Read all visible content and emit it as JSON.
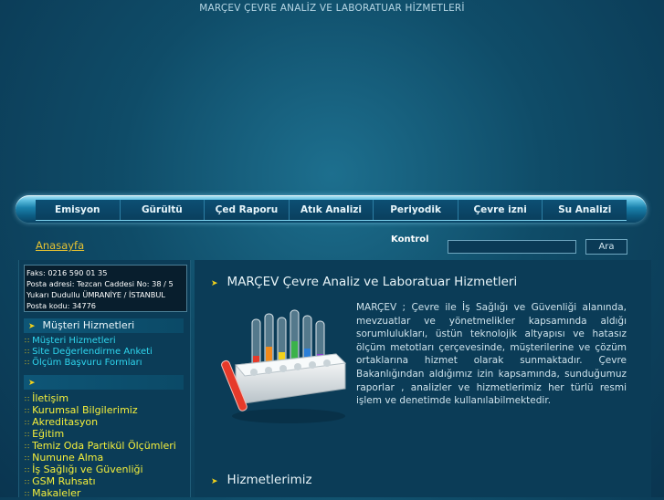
{
  "header": {
    "title": "MARÇEV ÇEVRE ANALİZ VE LABORATUAR HİZMETLERİ"
  },
  "nav": {
    "items": [
      "Emisyon",
      "Gürültü",
      "Çed Raporu",
      "Atık Analizi",
      "Periyodik",
      "Çevre izni",
      "Su Analizi"
    ]
  },
  "breadcrumb": {
    "home": "Anasayfa"
  },
  "search": {
    "label": "Kontrol",
    "value": "",
    "button": "Ara"
  },
  "contact": {
    "lines": [
      "Faks: 0216 590 01 35",
      "Posta adresi: Tezcan Caddesi No: 38 / 5",
      "Yukarı Dudullu ÜMRANİYE / İSTANBUL",
      "Posta kodu: 34776"
    ]
  },
  "sidebar": {
    "customer_heading": "Müşteri Hizmetleri",
    "customer_links": [
      "Müşteri Hizmetleri",
      "Site Değerlendirme Anketi",
      "Ölçüm Başvuru Formları"
    ],
    "second_heading": "",
    "links": [
      "İletişim",
      "Kurumsal Bilgilerimiz",
      "Akreditasyon",
      "Eğitim",
      "Temiz Oda Partikül Ölçümleri",
      "Numune Alma",
      "İş Sağlığı ve Güvenliği",
      "GSM Ruhsatı",
      "Makaleler"
    ]
  },
  "main": {
    "title": "MARÇEV Çevre Analiz ve Laboratuar Hizmetleri",
    "paragraph": "MARÇEV ; Çevre ile İş Sağlığı ve Güvenliği alanında, mevzuatlar ve yönetmelikler kapsamında aldığı sorumlulukları, üstün teknolojik altyapısı ve hatasız ölçüm metotları çerçevesinde, müşterilerine ve çözüm ortaklarına hizmet olarak sunmaktadır. Çevre Bakanlığından aldığımız izin kapsamında, sunduğumuz raporlar , analizler ve hizmetlerimiz her türlü resmi işlem ve denetimde kullanılabilmektedir.",
    "services_heading": "Hizmetlerimiz"
  },
  "icons": {
    "bullet": "arrow-bullet-icon",
    "image": "test-tubes-rack-icon"
  },
  "colors": {
    "accent_yellow": "#f2d21b",
    "link_cyan": "#2fd6ee",
    "link_yellow": "#f5ef3b",
    "bg": "#0b3c57"
  }
}
